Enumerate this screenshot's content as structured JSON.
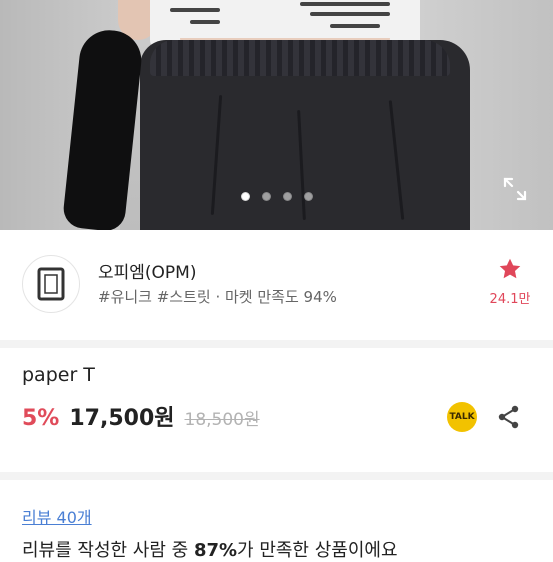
{
  "gallery": {
    "slide_count": 4,
    "active_slide": 1,
    "expand_icon": "expand-icon",
    "shirt_print_lines": [
      "the Fashion Empire",
      "Diane Built"
    ]
  },
  "shop": {
    "name": "오피엠(OPM)",
    "tags": "#유니크 #스트릿 · 마켓 만족도 94%",
    "favorite_icon": "star-icon",
    "favorite_count": "24.1만",
    "accent_color": "#e0475a"
  },
  "product": {
    "title": "paper T",
    "discount": "5%",
    "price": "17,500원",
    "original_price": "18,500원",
    "talk_label": "TALK",
    "share_icon": "share-icon"
  },
  "review": {
    "link_label": "리뷰 40개",
    "summary_prefix": "리뷰를 작성한 사람 중 ",
    "summary_percent": "87%",
    "summary_suffix": "가 만족한 상품이에요"
  }
}
